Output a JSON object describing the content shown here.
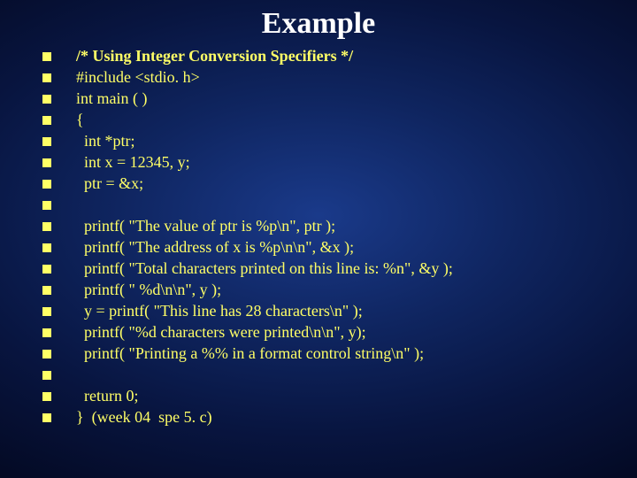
{
  "title": "Example",
  "lines": [
    {
      "text": "/* Using Integer Conversion Specifiers */",
      "bold": true
    },
    {
      "text": "#include <stdio. h>",
      "bold": false
    },
    {
      "text": "int main ( )",
      "bold": false
    },
    {
      "text": "{",
      "bold": false
    },
    {
      "text": "  int *ptr;",
      "bold": false
    },
    {
      "text": "  int x = 12345, y;",
      "bold": false
    },
    {
      "text": "  ptr = &x;",
      "bold": false
    },
    {
      "text": "",
      "bold": false
    },
    {
      "text": "  printf( \"The value of ptr is %p\\n\", ptr );",
      "bold": false
    },
    {
      "text": "  printf( \"The address of x is %p\\n\\n\", &x );",
      "bold": false
    },
    {
      "text": "  printf( \"Total characters printed on this line is: %n\", &y );",
      "bold": false
    },
    {
      "text": "  printf( \" %d\\n\\n\", y );",
      "bold": false
    },
    {
      "text": "  y = printf( \"This line has 28 characters\\n\" );",
      "bold": false
    },
    {
      "text": "  printf( \"%d characters were printed\\n\\n\", y);",
      "bold": false
    },
    {
      "text": "  printf( \"Printing a %% in a format control string\\n\" );",
      "bold": false
    },
    {
      "text": "",
      "bold": false
    },
    {
      "text": "  return 0;",
      "bold": false
    },
    {
      "text": "}  (week 04  spe 5. c)",
      "bold": false
    }
  ]
}
